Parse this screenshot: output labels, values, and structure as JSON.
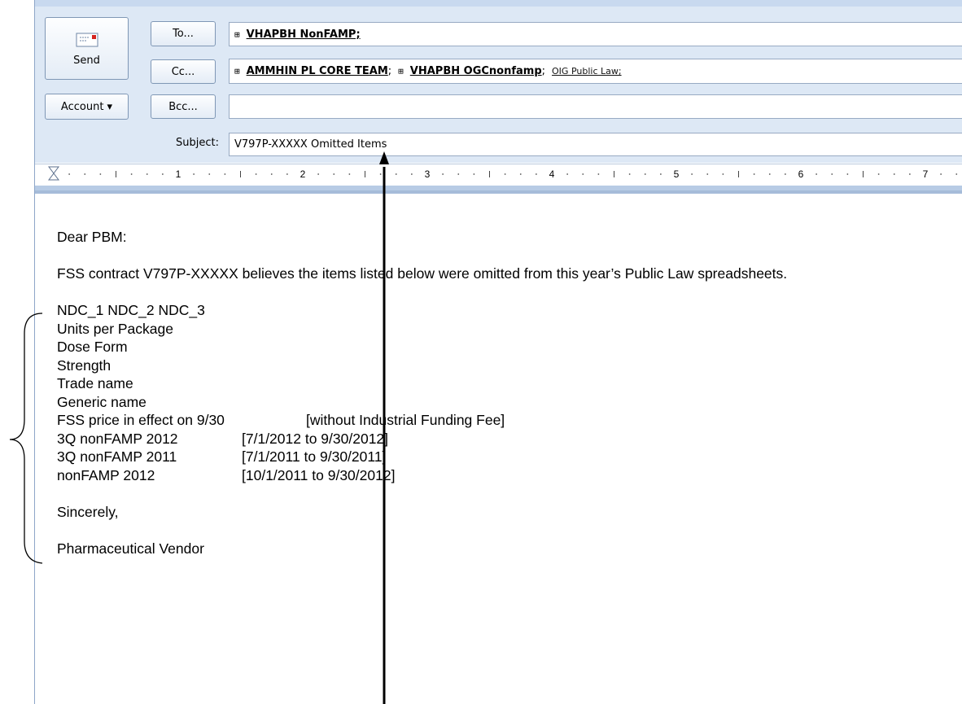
{
  "buttons": {
    "send_label": "Send",
    "account_label": "Account ▾",
    "to_label": "To...",
    "cc_label": "Cc...",
    "bcc_label": "Bcc..."
  },
  "fields": {
    "to": [
      "VHAPBH NonFAMP;"
    ],
    "cc": {
      "r1": "AMMHIN PL CORE TEAM",
      "r2": "VHAPBH OGCnonfamp",
      "r3": "OIG Public Law;"
    },
    "bcc": "",
    "subject_label": "Subject:",
    "subject": "V797P-XXXXX Omitted Items"
  },
  "ruler_numbers": [
    "1",
    "2",
    "3",
    "4",
    "5",
    "6",
    "7"
  ],
  "body": {
    "greeting": "Dear PBM:",
    "intro": "FSS contract V797P-XXXXX believes the items listed below were omitted from this year’s Public Law spreadsheets.",
    "items": [
      "NDC_1  NDC_2  NDC_3",
      "Units per Package",
      "Dose Form",
      "Strength",
      "Trade name",
      "Generic name"
    ],
    "price_rows": [
      {
        "label": "FSS price in effect on 9/30",
        "note": "[without Industrial Funding Fee]"
      },
      {
        "label": "3Q nonFAMP 2012",
        "note": "[7/1/2012 to 9/30/2012]"
      },
      {
        "label": "3Q nonFAMP 2011",
        "note": "[7/1/2011 to 9/30/2011]"
      },
      {
        "label": "nonFAMP 2012",
        "note": "[10/1/2011 to 9/30/2012]"
      }
    ],
    "closing": "Sincerely,",
    "signature": "Pharmaceutical Vendor"
  },
  "colors": {
    "header_bg": "#dde8f5",
    "ruler_accent": "#a6bcd9",
    "send_icon_red": "#d4231e"
  },
  "icons": [
    "send-envelope-icon",
    "dropdown-arrow-icon",
    "expand-plus-icon"
  ]
}
